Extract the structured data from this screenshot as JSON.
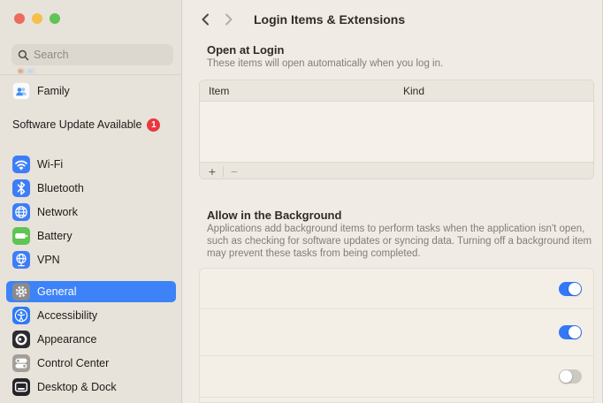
{
  "colors": {
    "accent": "#3d82f7",
    "toggle_on": "#3478f6",
    "toggle_off": "#ccc8c2",
    "badge_red": "#e8393e",
    "traffic_close": "#ee6a5e",
    "traffic_minimize": "#f5bf4e",
    "traffic_zoom": "#5fc454",
    "sidebar_bg": "#e7e2da",
    "main_bg": "#f0ebe4"
  },
  "sidebar": {
    "search_placeholder": "Search",
    "family_label": "Family",
    "software_update_label": "Software Update Available",
    "software_update_badge": "1",
    "network_items": [
      {
        "label": "Wi-Fi",
        "icon": "wifi-icon"
      },
      {
        "label": "Bluetooth",
        "icon": "bluetooth-icon"
      },
      {
        "label": "Network",
        "icon": "globe-icon"
      },
      {
        "label": "Battery",
        "icon": "battery-icon"
      },
      {
        "label": "VPN",
        "icon": "vpn-globe-icon"
      }
    ],
    "general_items": [
      {
        "label": "General",
        "icon": "gear-icon",
        "selected": true
      },
      {
        "label": "Accessibility",
        "icon": "accessibility-icon",
        "selected": false
      },
      {
        "label": "Appearance",
        "icon": "contrast-icon",
        "selected": false
      },
      {
        "label": "Control Center",
        "icon": "toggles-icon",
        "selected": false
      },
      {
        "label": "Desktop & Dock",
        "icon": "desktop-window-icon",
        "selected": false
      }
    ]
  },
  "header": {
    "title": "Login Items & Extensions"
  },
  "open_at_login": {
    "heading": "Open at Login",
    "description": "These items will open automatically when you log in.",
    "table": {
      "columns": [
        "Item",
        "Kind"
      ],
      "rows": [],
      "add_button": "+",
      "remove_button": "−"
    }
  },
  "allow_in_background": {
    "heading": "Allow in the Background",
    "description": "Applications add background items to perform tasks when the application isn't open, such as checking for software updates or syncing data. Turning off a background item may prevent these tasks from being completed.",
    "background_items": [
      {
        "toggle": "on"
      },
      {
        "toggle": "on"
      },
      {
        "toggle": "off"
      }
    ]
  }
}
